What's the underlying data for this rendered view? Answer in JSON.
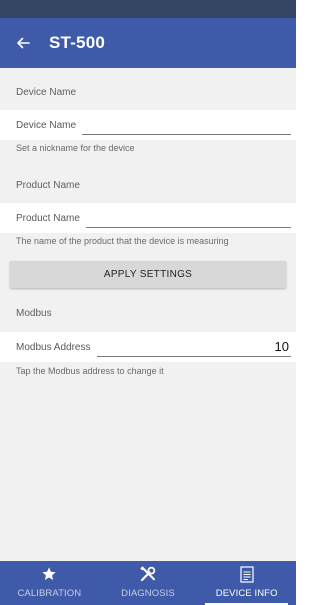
{
  "app": {
    "title": "ST-500"
  },
  "device_name": {
    "section_title": "Device Name",
    "label": "Device Name",
    "value": "",
    "helper": "Set a nickname for the device"
  },
  "product_name": {
    "section_title": "Product Name",
    "label": "Product Name",
    "value": "",
    "helper": "The name of the product that the device is measuring"
  },
  "apply_label": "APPLY SETTINGS",
  "modbus": {
    "section_title": "Modbus",
    "label": "Modbus Address",
    "value": "10",
    "helper": "Tap the Modbus address to change it"
  },
  "nav": {
    "tabs": [
      {
        "label": "CALIBRATION",
        "icon": "star-icon",
        "active": false
      },
      {
        "label": "DIAGNOSIS",
        "icon": "tools-icon",
        "active": false
      },
      {
        "label": "DEVICE INFO",
        "icon": "document-icon",
        "active": true
      }
    ]
  },
  "colors": {
    "appbar": "#3e5aa8",
    "statusbar": "#344463",
    "background": "#f1f1f1",
    "button": "#d8d8d8"
  }
}
